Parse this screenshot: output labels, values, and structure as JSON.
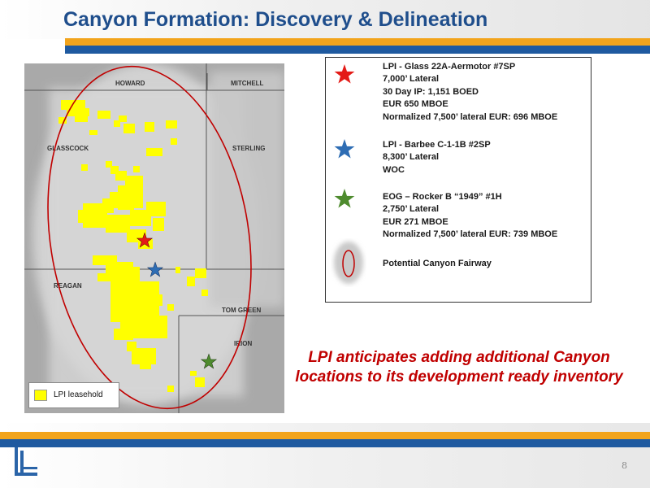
{
  "title": "Canyon Formation: Discovery & Delineation",
  "page_number": "8",
  "map": {
    "counties": [
      "HOWARD",
      "MITCHELL",
      "GLASSCOCK",
      "STERLING",
      "REAGAN",
      "TOM GREEN",
      "IRION"
    ],
    "leasehold_legend_label": "LPI leasehold",
    "leasehold_color": "#ffff00",
    "fairway_color": "#c00000"
  },
  "legend": {
    "entries": [
      {
        "icon": "red-star-icon",
        "color": "#e41b17",
        "lines": [
          "LPI - Glass 22A-Aermotor #7SP",
          "7,000’ Lateral",
          "30 Day IP:  1,151 BOED",
          "EUR 650 MBOE",
          "Normalized 7,500’ lateral EUR:  696 MBOE"
        ]
      },
      {
        "icon": "blue-star-icon",
        "color": "#2e6db4",
        "lines": [
          "LPI - Barbee C-1-1B #2SP",
          "8,300’ Lateral",
          "WOC"
        ]
      },
      {
        "icon": "green-star-icon",
        "color": "#4e8b2e",
        "lines": [
          "EOG – Rocker B “1949” #1H",
          "2,750’ Lateral",
          "EUR 271 MBOE",
          "Normalized 7,500’ lateral EUR:  739 MBOE"
        ]
      },
      {
        "icon": "fairway-ellipse-icon",
        "color": "#c00000",
        "lines": [
          "Potential Canyon Fairway"
        ]
      }
    ]
  },
  "callout": "LPI anticipates adding additional Canyon locations to its development ready inventory",
  "colors": {
    "title": "#1f4e8c",
    "band_blue": "#1f5aa0",
    "band_orange": "#f2a41c"
  }
}
